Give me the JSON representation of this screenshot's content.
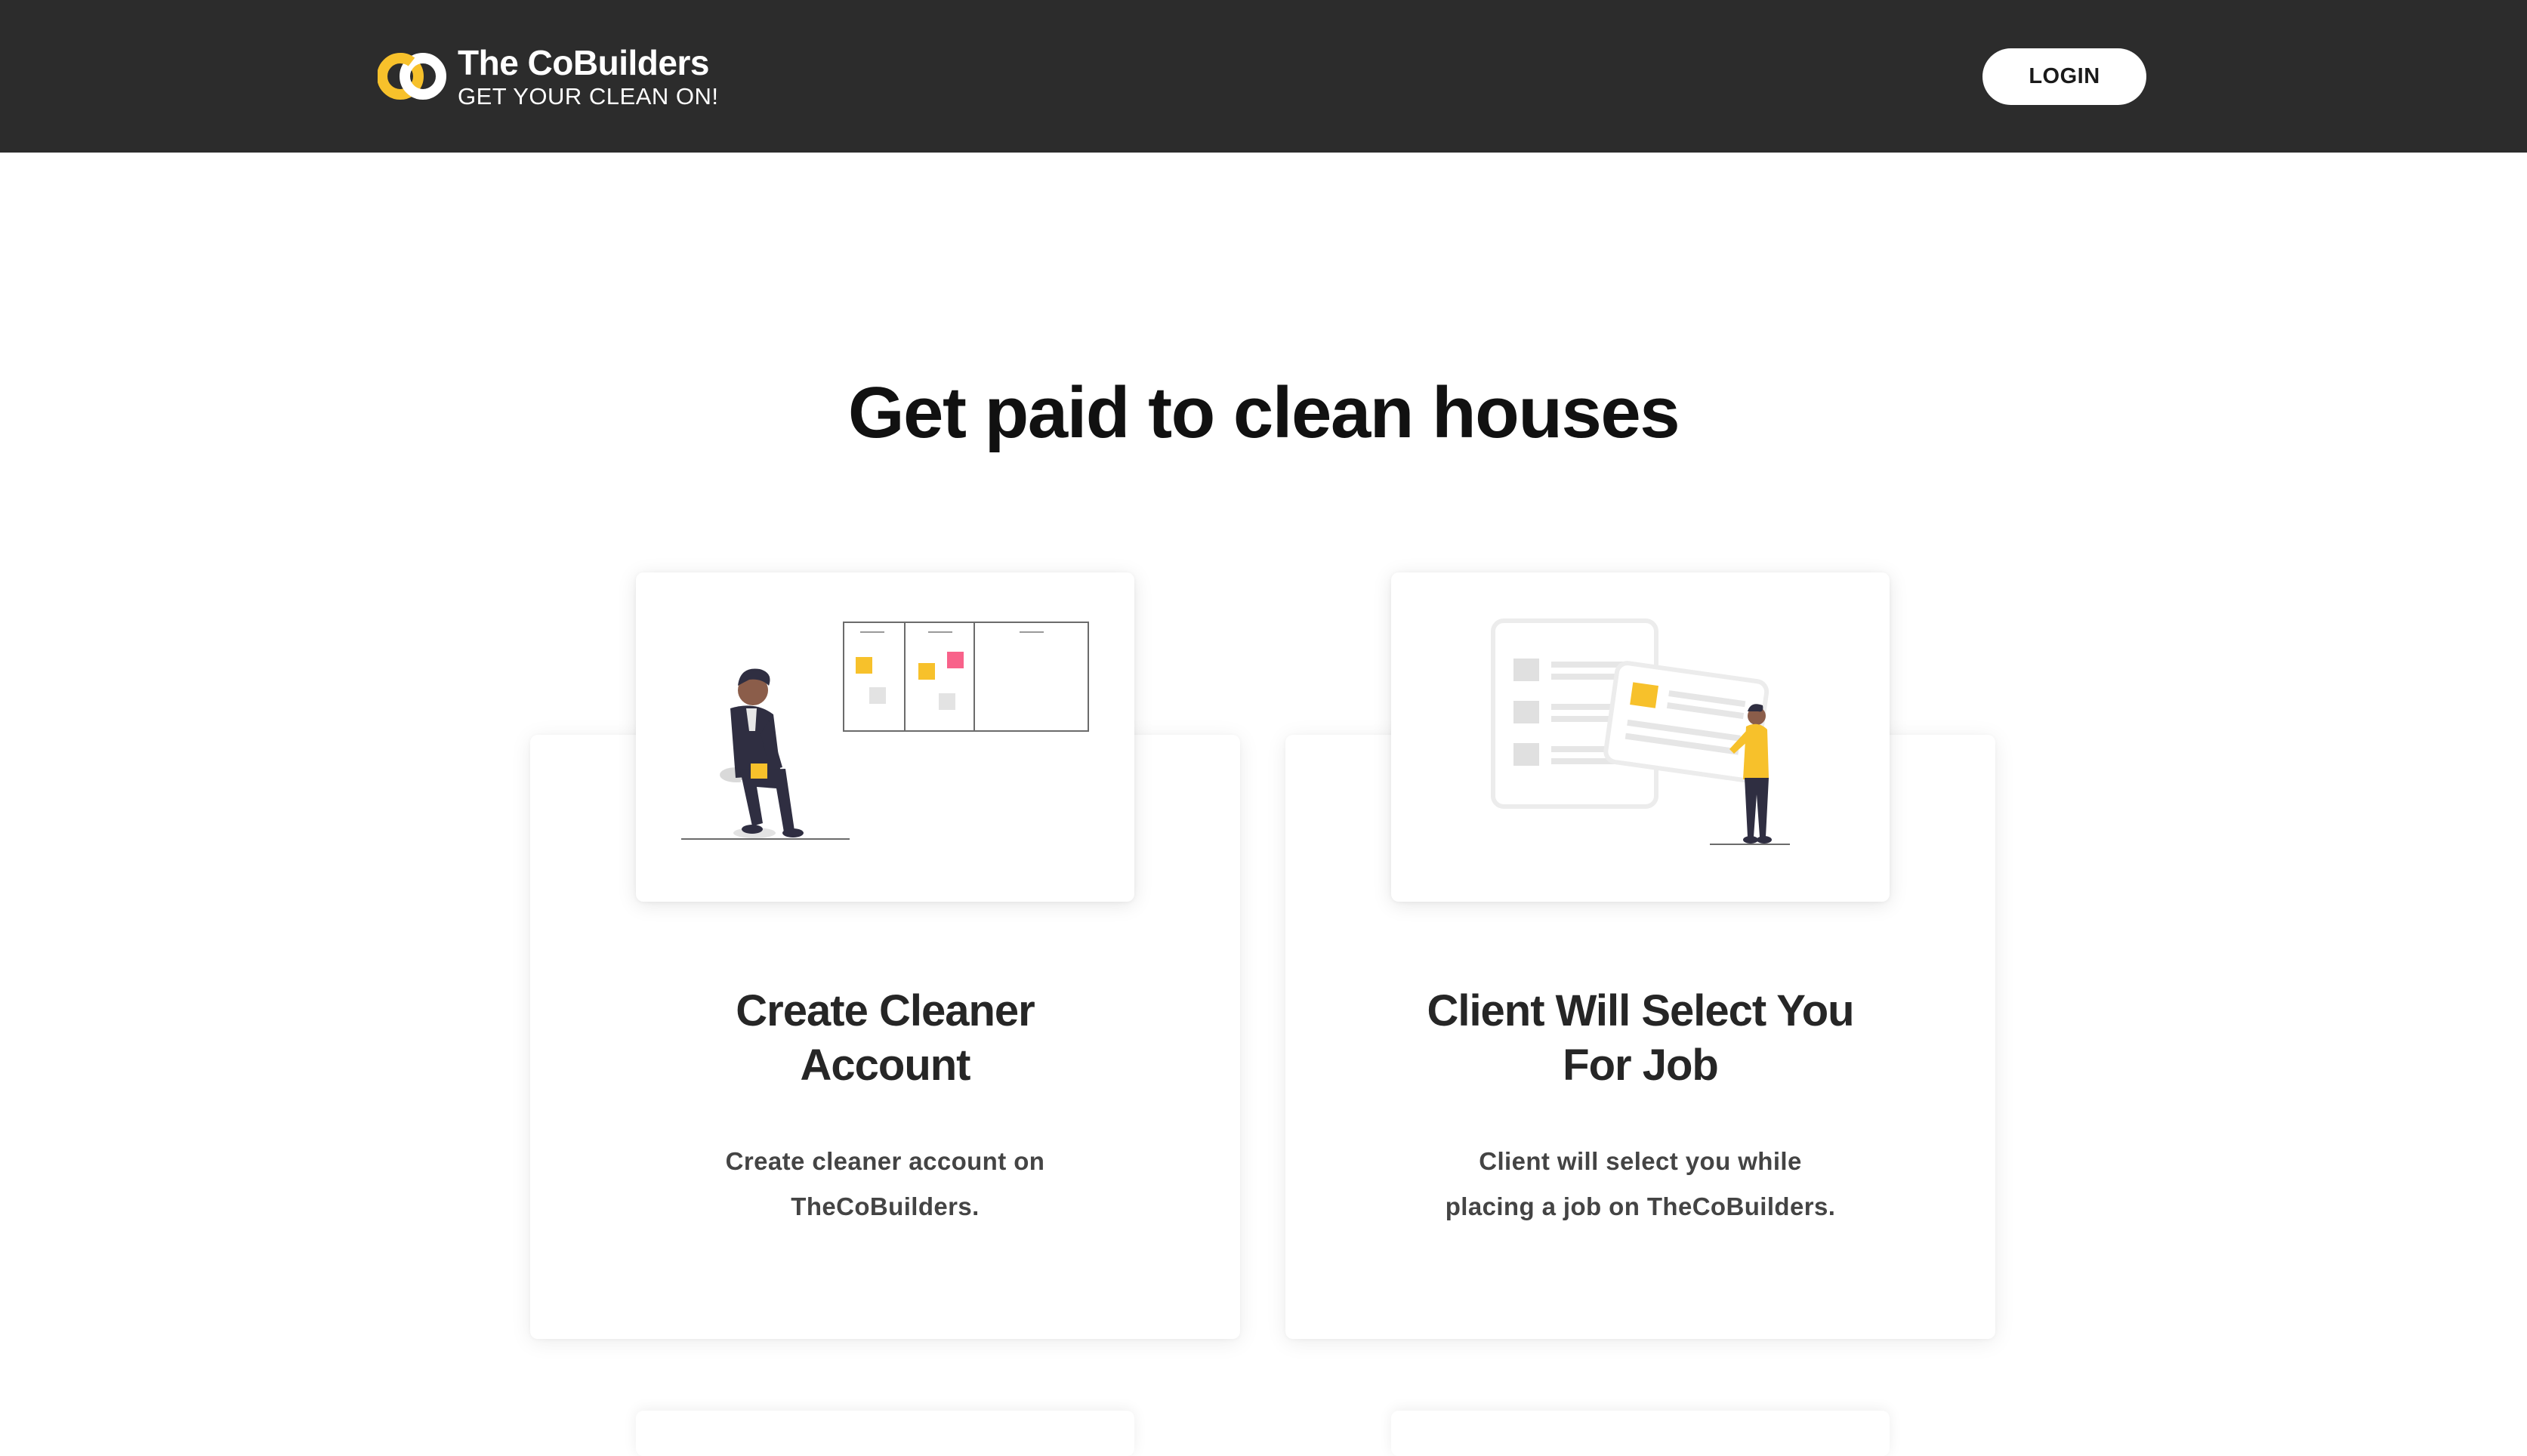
{
  "header": {
    "brand_name": "The CoBuilders",
    "brand_tagline": "GET YOUR CLEAN ON!",
    "logo_icon": "cobuilders-logo-icon",
    "login_label": "LOGIN"
  },
  "hero": {
    "title": "Get paid to clean houses"
  },
  "steps": [
    {
      "illustration": "person-sitting-task-board-illustration",
      "title_line1": "Create Cleaner",
      "title_line2": "Account",
      "desc_line1": "Create cleaner account on",
      "desc_line2": "TheCoBuilders."
    },
    {
      "illustration": "person-holding-card-list-illustration",
      "title_line1": "Client Will Select You",
      "title_line2": "For Job",
      "desc_line1": "Client will select you while",
      "desc_line2": "placing a job on TheCoBuilders."
    }
  ],
  "colors": {
    "header_bg": "#2c2c2c",
    "accent_yellow": "#f7c12b",
    "accent_pink": "#f8628a",
    "text_dark": "#111111",
    "text_muted": "#444444"
  }
}
